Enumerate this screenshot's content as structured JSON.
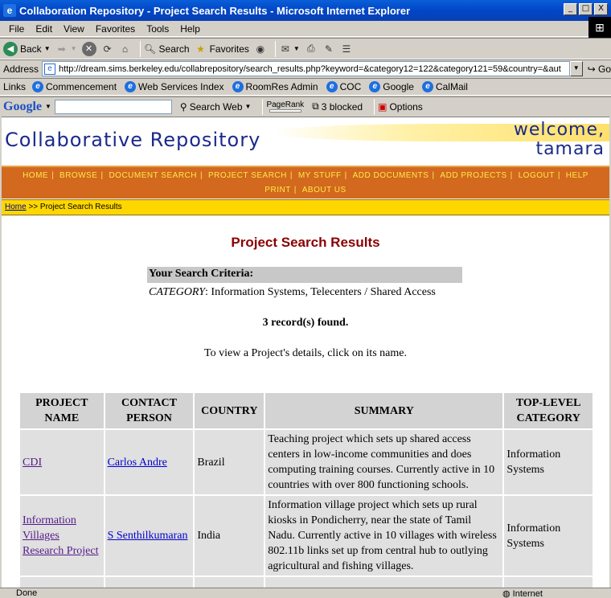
{
  "window": {
    "title": "Collaboration Repository - Project Search Results - Microsoft Internet Explorer",
    "minimize": "_",
    "maximize": "□",
    "close": "X"
  },
  "menu": [
    "File",
    "Edit",
    "View",
    "Favorites",
    "Tools",
    "Help"
  ],
  "toolbar": {
    "back": "Back",
    "search": "Search",
    "favorites": "Favorites"
  },
  "address": {
    "label": "Address",
    "url": "http://dream.sims.berkeley.edu/collabrepository/search_results.php?keyword=&category12=122&category121=59&country=&aut",
    "go": "Go"
  },
  "links": {
    "label": "Links",
    "items": [
      "Commencement",
      "Web Services Index",
      "RoomRes Admin",
      "COC",
      "Google",
      "CalMail"
    ]
  },
  "googlebar": {
    "logo": "Google",
    "search_web": "Search Web",
    "pagerank": "PageRank",
    "blocked": "3 blocked",
    "options": "Options"
  },
  "site": {
    "title": "Collaborative Repository",
    "welcome_line1": "welcome,",
    "welcome_line2": "tamara",
    "nav": [
      "HOME",
      "BROWSE",
      "DOCUMENT SEARCH",
      "PROJECT SEARCH",
      "MY STUFF",
      "ADD DOCUMENTS",
      "ADD PROJECTS",
      "LOGOUT",
      "HELP",
      "PRINT",
      "ABOUT US"
    ],
    "breadcrumb_home": "Home",
    "breadcrumb_rest": " >> Project Search Results"
  },
  "page": {
    "heading": "Project Search Results",
    "criteria_title": "Your Search Criteria:",
    "criteria_label": "CATEGORY",
    "criteria_value": ": Information Systems, Telecenters / Shared Access",
    "records": "3 record(s) found.",
    "hint": "To view a Project's details, click on its name."
  },
  "table": {
    "headers": [
      "PROJECT NAME",
      "CONTACT PERSON",
      "COUNTRY",
      "SUMMARY",
      "TOP-LEVEL CATEGORY"
    ],
    "rows": [
      {
        "name": "CDI",
        "contact": "Carlos Andre",
        "country": "Brazil",
        "summary": "Teaching project which sets up shared access centers in low-income communities and does computing training courses. Currently active in 10 countries with over 800 functioning schools.",
        "category": "Information Systems"
      },
      {
        "name": "Information Villages Research Project",
        "contact": "S Senthilkumaran",
        "country": "India",
        "summary": "Information village project which sets up rural kiosks in Pondicherry, near the state of Tamil Nadu. Currently active in 10 villages with wireless 802.11b links set up from central hub to outlying agricultural and fishing villages.",
        "category": "Information Systems"
      }
    ]
  },
  "status": {
    "left": "Done",
    "zone": "Internet"
  }
}
